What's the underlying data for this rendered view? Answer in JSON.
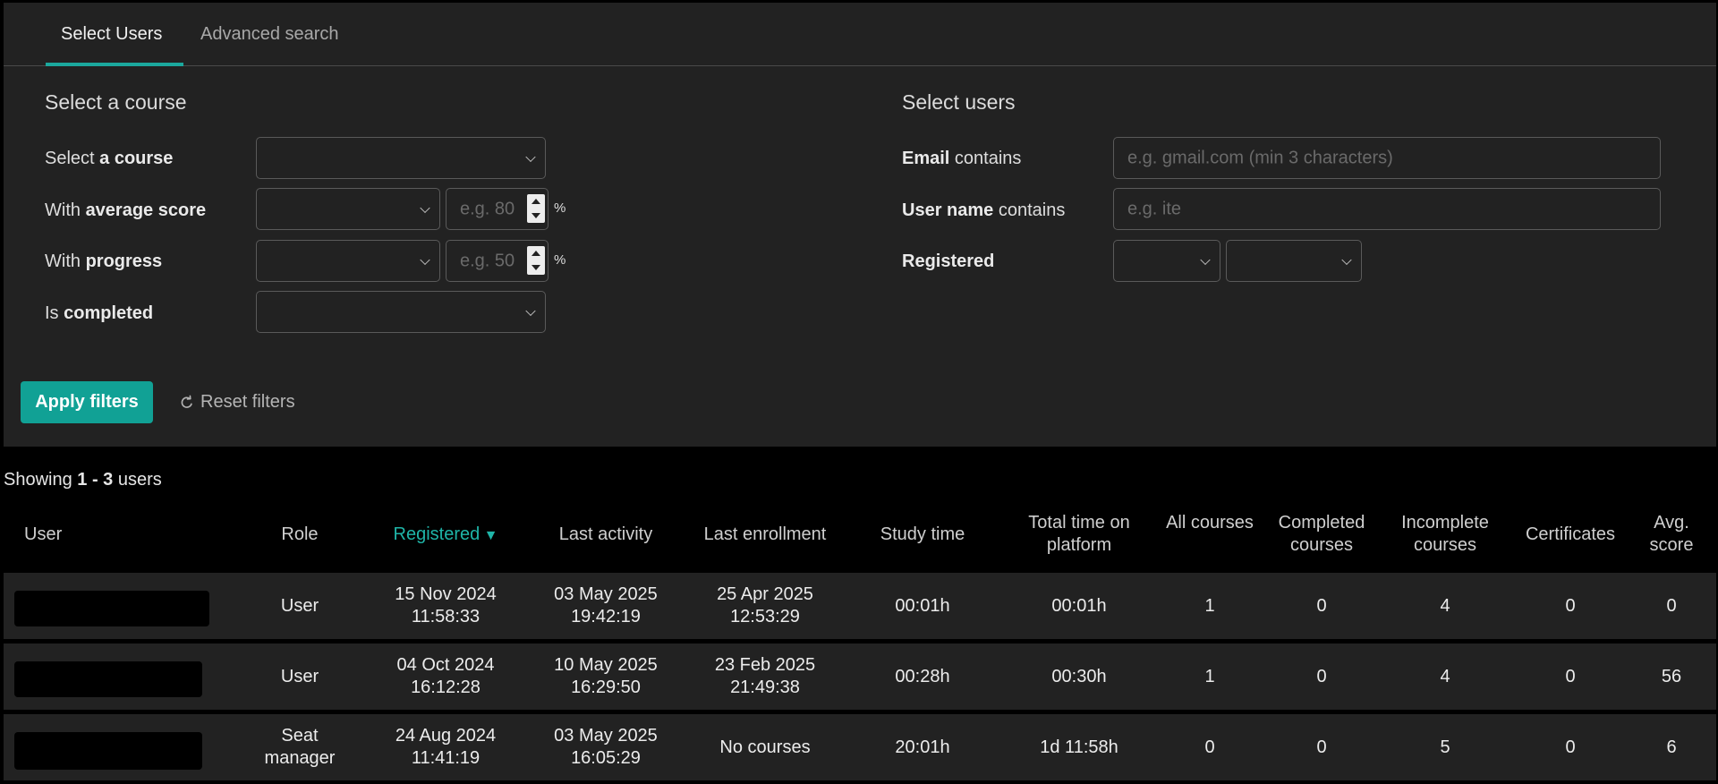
{
  "tabs": [
    {
      "label": "Select Users",
      "active": true
    },
    {
      "label": "Advanced search",
      "active": false
    }
  ],
  "course_section": {
    "title": "Select a course",
    "fields": {
      "course": {
        "prefix": "Select ",
        "bold": "a course",
        "suffix": ""
      },
      "average_score": {
        "prefix": "With ",
        "bold": "average score",
        "suffix": "",
        "placeholder": "e.g. 80",
        "unit": "%"
      },
      "progress": {
        "prefix": "With ",
        "bold": "progress",
        "suffix": "",
        "placeholder": "e.g. 50",
        "unit": "%"
      },
      "completed": {
        "prefix": "Is ",
        "bold": "completed",
        "suffix": ""
      }
    }
  },
  "users_section": {
    "title": "Select users",
    "fields": {
      "email": {
        "bold": "Email",
        "suffix": " contains",
        "placeholder": "e.g. gmail.com (min 3 characters)"
      },
      "username": {
        "bold": "User name",
        "suffix": " contains",
        "placeholder": "e.g. ite"
      },
      "registered": {
        "bold": "Registered"
      }
    }
  },
  "buttons": {
    "apply": "Apply filters",
    "reset": "Reset filters"
  },
  "results": {
    "showing_prefix": "Showing ",
    "showing_range": "1 - 3",
    "showing_suffix": " users"
  },
  "table": {
    "columns": [
      {
        "key": "user",
        "label": "User"
      },
      {
        "key": "role",
        "label": "Role"
      },
      {
        "key": "registered",
        "label": "Registered",
        "sorted": "desc"
      },
      {
        "key": "last_activity",
        "label": "Last activity"
      },
      {
        "key": "last_enrollment",
        "label": "Last enrollment"
      },
      {
        "key": "study_time",
        "label": "Study time"
      },
      {
        "key": "total_time",
        "label": "Total time on platform"
      },
      {
        "key": "all_courses",
        "label": "All courses"
      },
      {
        "key": "completed_courses",
        "label": "Completed courses"
      },
      {
        "key": "incomplete_courses",
        "label": "Incomplete courses"
      },
      {
        "key": "certificates",
        "label": "Certificates"
      },
      {
        "key": "avg_score",
        "label": "Avg. score"
      }
    ],
    "sort_indicator": "▼",
    "rows": [
      {
        "role": "User",
        "registered": "15 Nov 2024 11:58:33",
        "last_activity": "03 May 2025 19:42:19",
        "last_enrollment": "25 Apr 2025 12:53:29",
        "study_time": "00:01h",
        "total_time": "00:01h",
        "all_courses": "1",
        "completed_courses": "0",
        "incomplete_courses": "4",
        "certificates": "0",
        "avg_score": "0"
      },
      {
        "role": "User",
        "registered": "04 Oct 2024 16:12:28",
        "last_activity": "10 May 2025 16:29:50",
        "last_enrollment": "23 Feb 2025 21:49:38",
        "study_time": "00:28h",
        "total_time": "00:30h",
        "all_courses": "1",
        "completed_courses": "0",
        "incomplete_courses": "4",
        "certificates": "0",
        "avg_score": "56"
      },
      {
        "role": "Seat manager",
        "registered": "24 Aug 2024 11:41:19",
        "last_activity": "03 May 2025 16:05:29",
        "last_enrollment": "No courses",
        "study_time": "20:01h",
        "total_time": "1d 11:58h",
        "all_courses": "0",
        "completed_courses": "0",
        "incomplete_courses": "5",
        "certificates": "0",
        "avg_score": "6"
      }
    ]
  },
  "colors": {
    "accent": "#11a195",
    "panel_bg": "#222222",
    "page_bg": "#000000"
  }
}
